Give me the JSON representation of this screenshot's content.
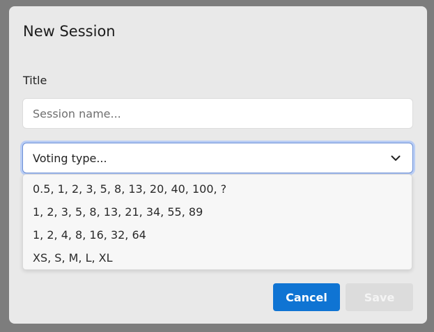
{
  "dialog": {
    "title": "New Session",
    "title_label": "Title",
    "title_placeholder": "Session name...",
    "voting": {
      "selected_label": "Voting type...",
      "icon": "chevron-down-icon",
      "options": [
        "0.5, 1, 2, 3, 5, 8, 13, 20, 40, 100, ?",
        "1, 2, 3, 5, 8, 13, 21, 34, 55, 89",
        "1, 2, 4, 8, 16, 32, 64",
        "XS, S, M, L, XL"
      ]
    },
    "buttons": {
      "cancel": "Cancel",
      "save": "Save"
    }
  },
  "colors": {
    "overlay": "#7d7d7d",
    "dialog_bg": "#e9e9e9",
    "primary": "#0f74d3",
    "disabled": "#dcdcdc",
    "focus_ring": "#b9cdf4"
  }
}
